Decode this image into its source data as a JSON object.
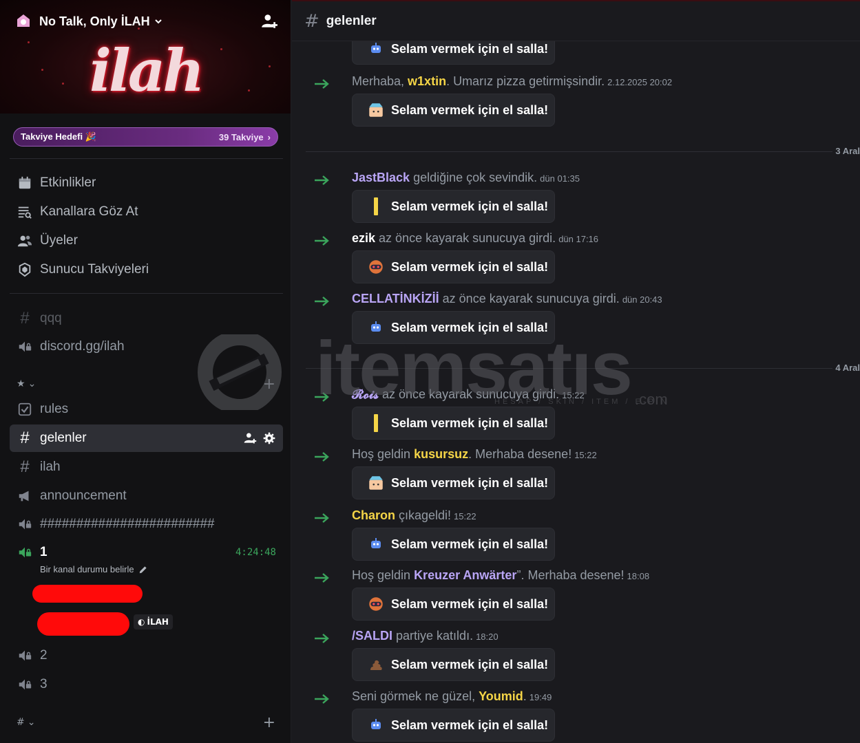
{
  "server": {
    "name": "No Talk, Only İLAH"
  },
  "boost": {
    "label": "Takviye Hedefi 🎉",
    "count": "39 Takviye"
  },
  "menu": [
    {
      "label": "Etkinlikler",
      "icon": "calendar-icon"
    },
    {
      "label": "Kanallara Göz At",
      "icon": "browse-channels-icon"
    },
    {
      "label": "Üyeler",
      "icon": "members-icon"
    },
    {
      "label": "Sunucu Takviyeleri",
      "icon": "boost-shield-icon"
    }
  ],
  "channels": {
    "qqq": "qqq",
    "invite": "discord.gg/ilah",
    "category_star": "★",
    "rules": "rules",
    "gelenler": "gelenler",
    "ilah": "ilah",
    "announcement": "announcement",
    "hashes": "########################",
    "voice1": "1",
    "voice1_timer": "4:24:48",
    "voice1_status": "Bir kanal durumu belirle",
    "voice_tag": "İLAH",
    "voice2": "2",
    "voice3": "3",
    "category_hash": "#"
  },
  "topbar": {
    "channel": "gelenler"
  },
  "wave_label": "Selam vermek için el salla!",
  "days": {
    "d3": "3 Aral",
    "d4": "4 Aral"
  },
  "messages": [
    {
      "pre": "Merhaba, ",
      "user": "w1xtin",
      "user_color": "#f5d547",
      "post": ". Umarız pizza getirmişsindir.",
      "ts": "2.12.2025 20:02"
    },
    {
      "pre": "",
      "user": "JastBlack",
      "user_color": "#b9a5f5",
      "post": " geldiğine çok sevindik.",
      "ts": "dün 01:35"
    },
    {
      "pre": "",
      "user": "ezik",
      "user_color": "#ffffff",
      "post": " az önce kayarak sunucuya girdi.",
      "ts": "dün 17:16"
    },
    {
      "pre": "",
      "user": "CELLATİNKİZİİ",
      "user_color": "#b9a5f5",
      "post": " az önce kayarak sunucuya girdi.",
      "ts": "dün 20:43"
    },
    {
      "pre": "",
      "user": "𝓡𝓸𝓲𝓼",
      "user_color": "#b9a5f5",
      "post": " az önce kayarak sunucuya girdi.",
      "ts": "15:22"
    },
    {
      "pre": "Hoş geldin ",
      "user": "kusursuz",
      "user_color": "#f5d547",
      "post": ". Merhaba desene!",
      "ts": "15:22"
    },
    {
      "pre": "",
      "user": "Charon",
      "user_color": "#f5d547",
      "post": " çıkageldi!",
      "ts": "15:22"
    },
    {
      "pre": "Hoş geldin ",
      "user": "Kreuzer Anwärter",
      "user_color": "#b9a5f5",
      "post": "”. Merhaba desene!",
      "ts": "18:08"
    },
    {
      "pre": "",
      "user": "/SALDI",
      "user_color": "#b9a5f5",
      "post": " partiye katıldı.",
      "ts": "18:20"
    },
    {
      "pre": "Seni görmek ne güzel, ",
      "user": "Youmid",
      "user_color": "#f5d547",
      "post": ".",
      "ts": "19:49"
    }
  ],
  "watermark": {
    "text": "itemsatıs",
    "sub": "HESAP / SKIN / ITEM / E-PIN",
    "com": ".com"
  },
  "colors": {
    "accent_green": "#3ba55c",
    "boost_purple": "#6a2c80",
    "redaction": "#ff0a0a"
  }
}
